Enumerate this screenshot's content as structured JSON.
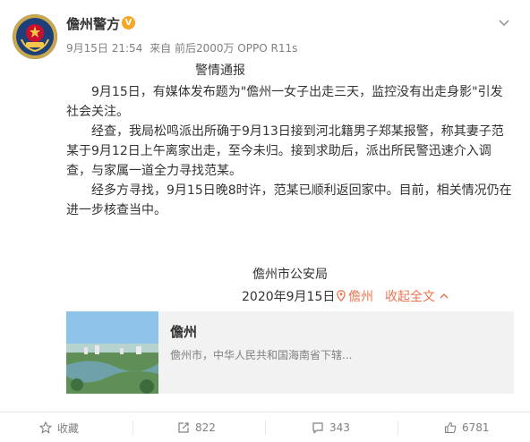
{
  "post": {
    "author": "儋州警方",
    "time": "9月15日 21:54",
    "source": "来自 前后2000万 OPPO R11s"
  },
  "notice": {
    "title": "警情通报",
    "p1": "9月15日，有媒体发布题为\"儋州一女子出走三天，监控没有出走身影\"引发社会关注。",
    "p2": "经查，我局松鸣派出所确于9月13日接到河北籍男子郑某报警，称其妻子范某于9月12日上午离家出走，至今未归。接到求助后，派出所民警迅速介入调查，与家属一道全力寻找范某。",
    "p3": "经多方寻找，9月15日晚8时许，范某已顺利返回家中。目前，相关情况仍在进一步核查当中。",
    "signature": "儋州市公安局",
    "date": "2020年9月15日",
    "location": "儋州",
    "collapse": "收起全文"
  },
  "card": {
    "title": "儋州",
    "desc": "儋州市，中华人民共和国海南省下辖..."
  },
  "actions": {
    "favorite": "收藏",
    "repost": "822",
    "comment": "343",
    "like": "6781"
  },
  "colors": {
    "accent": "#eb7350",
    "verified": "#f5a623",
    "muted": "#808080"
  }
}
